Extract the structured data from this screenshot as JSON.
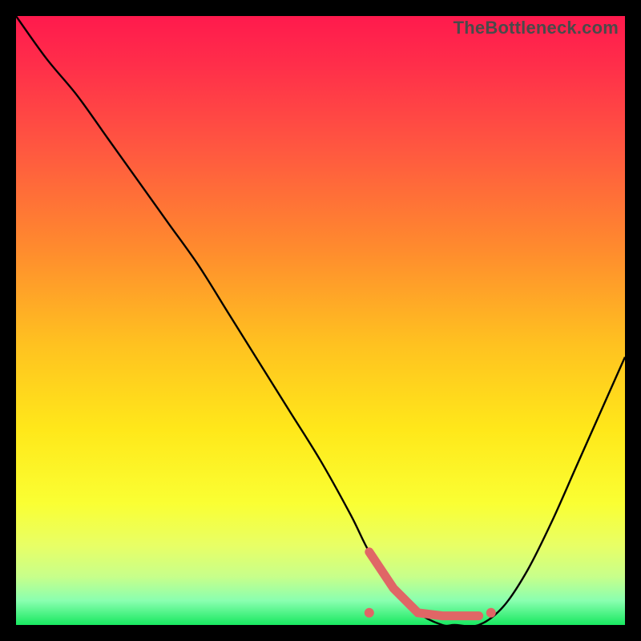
{
  "watermark": "TheBottleneck.com",
  "colors": {
    "frame": "#000000",
    "curve": "#000000",
    "marker": "#e06666",
    "gradient_stops": [
      "#ff1a4d",
      "#ff2e4a",
      "#ff5840",
      "#ff8a2e",
      "#ffc220",
      "#ffe81a",
      "#faff33",
      "#e8ff66",
      "#c8ff8a",
      "#8affb0",
      "#18e860"
    ]
  },
  "chart_data": {
    "type": "line",
    "title": "",
    "xlabel": "",
    "ylabel": "",
    "xlim": [
      0,
      100
    ],
    "ylim": [
      0,
      100
    ],
    "series": [
      {
        "name": "bottleneck-curve",
        "x": [
          0,
          5,
          10,
          15,
          20,
          25,
          30,
          35,
          40,
          45,
          50,
          55,
          58,
          62,
          66,
          70,
          72,
          76,
          80,
          84,
          88,
          92,
          96,
          100
        ],
        "values": [
          100,
          93,
          87,
          80,
          73,
          66,
          59,
          51,
          43,
          35,
          27,
          18,
          12,
          6,
          2,
          0,
          0,
          0,
          3,
          9,
          17,
          26,
          35,
          44
        ]
      }
    ],
    "markers": [
      {
        "name": "valley-left",
        "x": 58,
        "y": 2
      },
      {
        "name": "valley-right",
        "x": 78,
        "y": 2
      }
    ],
    "valley_band": {
      "x_start": 58,
      "x_end": 78,
      "y": 1.5
    }
  }
}
